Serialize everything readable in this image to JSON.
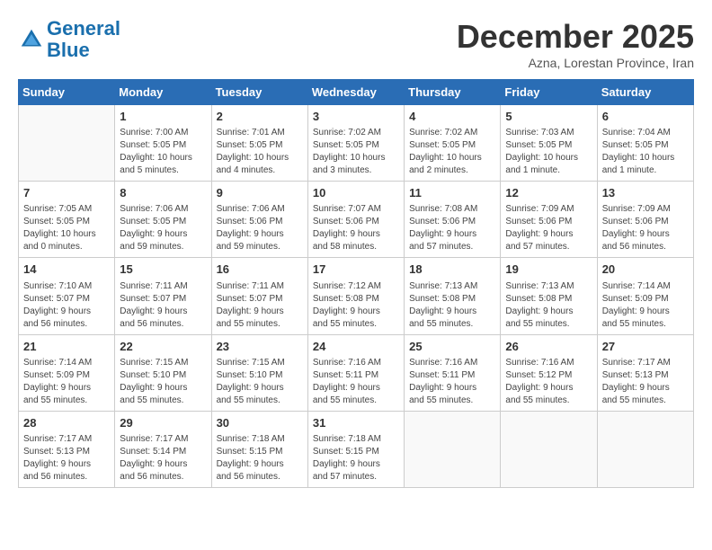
{
  "header": {
    "logo_line1": "General",
    "logo_line2": "Blue",
    "month": "December 2025",
    "location": "Azna, Lorestan Province, Iran"
  },
  "days_of_week": [
    "Sunday",
    "Monday",
    "Tuesday",
    "Wednesday",
    "Thursday",
    "Friday",
    "Saturday"
  ],
  "weeks": [
    [
      {
        "num": "",
        "info": ""
      },
      {
        "num": "1",
        "info": "Sunrise: 7:00 AM\nSunset: 5:05 PM\nDaylight: 10 hours\nand 5 minutes."
      },
      {
        "num": "2",
        "info": "Sunrise: 7:01 AM\nSunset: 5:05 PM\nDaylight: 10 hours\nand 4 minutes."
      },
      {
        "num": "3",
        "info": "Sunrise: 7:02 AM\nSunset: 5:05 PM\nDaylight: 10 hours\nand 3 minutes."
      },
      {
        "num": "4",
        "info": "Sunrise: 7:02 AM\nSunset: 5:05 PM\nDaylight: 10 hours\nand 2 minutes."
      },
      {
        "num": "5",
        "info": "Sunrise: 7:03 AM\nSunset: 5:05 PM\nDaylight: 10 hours\nand 1 minute."
      },
      {
        "num": "6",
        "info": "Sunrise: 7:04 AM\nSunset: 5:05 PM\nDaylight: 10 hours\nand 1 minute."
      }
    ],
    [
      {
        "num": "7",
        "info": "Sunrise: 7:05 AM\nSunset: 5:05 PM\nDaylight: 10 hours\nand 0 minutes."
      },
      {
        "num": "8",
        "info": "Sunrise: 7:06 AM\nSunset: 5:05 PM\nDaylight: 9 hours\nand 59 minutes."
      },
      {
        "num": "9",
        "info": "Sunrise: 7:06 AM\nSunset: 5:06 PM\nDaylight: 9 hours\nand 59 minutes."
      },
      {
        "num": "10",
        "info": "Sunrise: 7:07 AM\nSunset: 5:06 PM\nDaylight: 9 hours\nand 58 minutes."
      },
      {
        "num": "11",
        "info": "Sunrise: 7:08 AM\nSunset: 5:06 PM\nDaylight: 9 hours\nand 57 minutes."
      },
      {
        "num": "12",
        "info": "Sunrise: 7:09 AM\nSunset: 5:06 PM\nDaylight: 9 hours\nand 57 minutes."
      },
      {
        "num": "13",
        "info": "Sunrise: 7:09 AM\nSunset: 5:06 PM\nDaylight: 9 hours\nand 56 minutes."
      }
    ],
    [
      {
        "num": "14",
        "info": "Sunrise: 7:10 AM\nSunset: 5:07 PM\nDaylight: 9 hours\nand 56 minutes."
      },
      {
        "num": "15",
        "info": "Sunrise: 7:11 AM\nSunset: 5:07 PM\nDaylight: 9 hours\nand 56 minutes."
      },
      {
        "num": "16",
        "info": "Sunrise: 7:11 AM\nSunset: 5:07 PM\nDaylight: 9 hours\nand 55 minutes."
      },
      {
        "num": "17",
        "info": "Sunrise: 7:12 AM\nSunset: 5:08 PM\nDaylight: 9 hours\nand 55 minutes."
      },
      {
        "num": "18",
        "info": "Sunrise: 7:13 AM\nSunset: 5:08 PM\nDaylight: 9 hours\nand 55 minutes."
      },
      {
        "num": "19",
        "info": "Sunrise: 7:13 AM\nSunset: 5:08 PM\nDaylight: 9 hours\nand 55 minutes."
      },
      {
        "num": "20",
        "info": "Sunrise: 7:14 AM\nSunset: 5:09 PM\nDaylight: 9 hours\nand 55 minutes."
      }
    ],
    [
      {
        "num": "21",
        "info": "Sunrise: 7:14 AM\nSunset: 5:09 PM\nDaylight: 9 hours\nand 55 minutes."
      },
      {
        "num": "22",
        "info": "Sunrise: 7:15 AM\nSunset: 5:10 PM\nDaylight: 9 hours\nand 55 minutes."
      },
      {
        "num": "23",
        "info": "Sunrise: 7:15 AM\nSunset: 5:10 PM\nDaylight: 9 hours\nand 55 minutes."
      },
      {
        "num": "24",
        "info": "Sunrise: 7:16 AM\nSunset: 5:11 PM\nDaylight: 9 hours\nand 55 minutes."
      },
      {
        "num": "25",
        "info": "Sunrise: 7:16 AM\nSunset: 5:11 PM\nDaylight: 9 hours\nand 55 minutes."
      },
      {
        "num": "26",
        "info": "Sunrise: 7:16 AM\nSunset: 5:12 PM\nDaylight: 9 hours\nand 55 minutes."
      },
      {
        "num": "27",
        "info": "Sunrise: 7:17 AM\nSunset: 5:13 PM\nDaylight: 9 hours\nand 55 minutes."
      }
    ],
    [
      {
        "num": "28",
        "info": "Sunrise: 7:17 AM\nSunset: 5:13 PM\nDaylight: 9 hours\nand 56 minutes."
      },
      {
        "num": "29",
        "info": "Sunrise: 7:17 AM\nSunset: 5:14 PM\nDaylight: 9 hours\nand 56 minutes."
      },
      {
        "num": "30",
        "info": "Sunrise: 7:18 AM\nSunset: 5:15 PM\nDaylight: 9 hours\nand 56 minutes."
      },
      {
        "num": "31",
        "info": "Sunrise: 7:18 AM\nSunset: 5:15 PM\nDaylight: 9 hours\nand 57 minutes."
      },
      {
        "num": "",
        "info": ""
      },
      {
        "num": "",
        "info": ""
      },
      {
        "num": "",
        "info": ""
      }
    ]
  ]
}
